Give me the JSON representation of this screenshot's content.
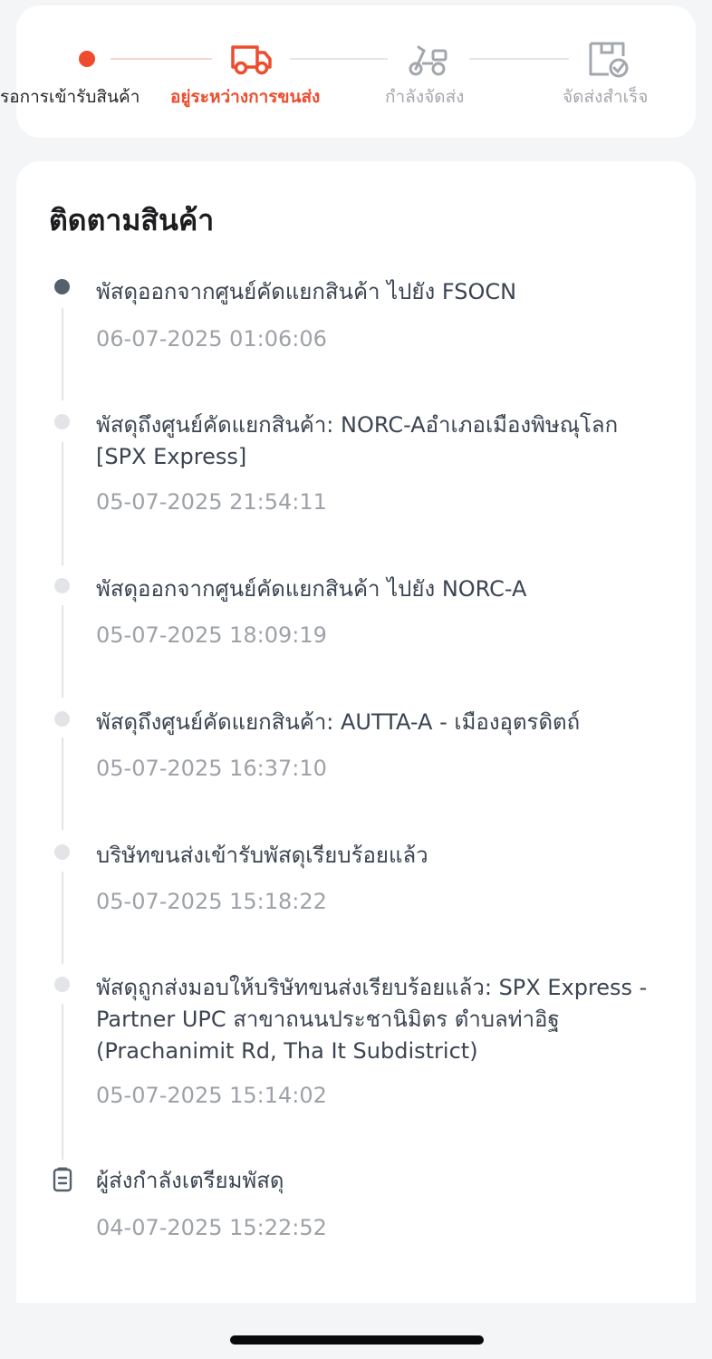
{
  "stepper": {
    "steps": [
      {
        "label": "รอการเข้ารับสินค้า",
        "state": "done"
      },
      {
        "label": "อยู่ระหว่างการขนส่ง",
        "state": "current",
        "icon": "truck-icon"
      },
      {
        "label": "กำลังจัดส่ง",
        "state": "pending",
        "icon": "scooter-icon"
      },
      {
        "label": "จัดส่งสำเร็จ",
        "state": "pending",
        "icon": "package-check-icon"
      }
    ],
    "accent_color": "#ee4d2d",
    "inactive_color": "#a3a7ad"
  },
  "tracking": {
    "title": "ติดตามสินค้า",
    "events": [
      {
        "text": "พัสดุออกจากศูนย์คัดแยกสินค้า ไปยัง FSOCN",
        "time": "06-07-2025 01:06:06",
        "active": true
      },
      {
        "text": "พัสดุถึงศูนย์คัดแยกสินค้า: NORC-Aอำเภอเมืองพิษณุโลก [SPX Express]",
        "time": "05-07-2025 21:54:11"
      },
      {
        "text": "พัสดุออกจากศูนย์คัดแยกสินค้า ไปยัง NORC-A",
        "time": "05-07-2025 18:09:19"
      },
      {
        "text": "พัสดุถึงศูนย์คัดแยกสินค้า: AUTTA-A - เมืองอุตรดิตถ์",
        "time": "05-07-2025 16:37:10"
      },
      {
        "text": "บริษัทขนส่งเข้ารับพัสดุเรียบร้อยแล้ว",
        "time": "05-07-2025 15:18:22"
      },
      {
        "text": "พัสดุถูกส่งมอบให้บริษัทขนส่งเรียบร้อยแล้ว: SPX Express - Partner UPC สาขาถนนประชานิมิตร ตำบลท่าอิฐ (Prachanimit Rd, Tha It Subdistrict)",
        "time": "05-07-2025 15:14:02"
      },
      {
        "text": "ผู้ส่งกำลังเตรียมพัสดุ",
        "time": "04-07-2025 15:22:52",
        "icon": "clipboard-icon"
      }
    ]
  }
}
